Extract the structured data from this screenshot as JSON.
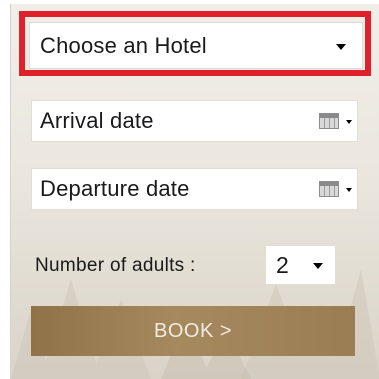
{
  "booking_form": {
    "hotel_select": {
      "selected": "Choose an Hotel"
    },
    "arrival_date": {
      "placeholder": "Arrival date"
    },
    "departure_date": {
      "placeholder": "Departure date"
    },
    "adults": {
      "label": "Number of adults :",
      "selected": "2"
    },
    "book_button": {
      "label": "BOOK >"
    }
  },
  "colors": {
    "highlight_outline": "#e0202a",
    "book_button": "#9a7d52",
    "panel_background": "#ebe7df"
  },
  "icons": [
    "dropdown-caret-icon",
    "calendar-icon"
  ]
}
